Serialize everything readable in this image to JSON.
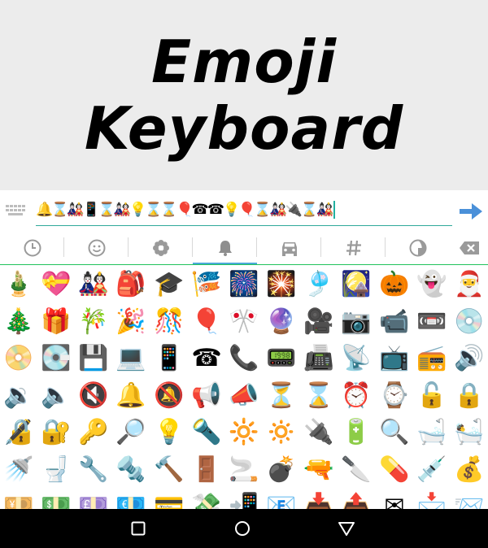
{
  "banner": {
    "line1": "Emoji",
    "line2": "Keyboard"
  },
  "input": {
    "text": "🔔⌛🎎📱⌛🎎💡⌛⌛🎈☎☎💡🎈⌛🎎🔌⌛🎎"
  },
  "tabs": [
    {
      "name": "recent",
      "icon": "clock-icon"
    },
    {
      "name": "smileys",
      "icon": "smiley-icon"
    },
    {
      "name": "flowers",
      "icon": "flower-icon"
    },
    {
      "name": "bell",
      "icon": "bell-icon",
      "active": true
    },
    {
      "name": "car",
      "icon": "car-icon"
    },
    {
      "name": "symbols",
      "icon": "hash-icon"
    },
    {
      "name": "themes",
      "icon": "moon-icon"
    }
  ],
  "emoji_rows": [
    [
      "🎍",
      "💝",
      "🎎",
      "🎒",
      "🎓",
      "🎏",
      "🎆",
      "🎇",
      "🎐",
      "🎑",
      "🎃",
      "👻",
      "🎅"
    ],
    [
      "🎄",
      "🎁",
      "🎋",
      "🎉",
      "🎊",
      "🎈",
      "🎌",
      "🔮",
      "🎥",
      "📷",
      "📹",
      "📼",
      "💿"
    ],
    [
      "📀",
      "💽",
      "💾",
      "💻",
      "📱",
      "☎",
      "📞",
      "📟",
      "📠",
      "📡",
      "📺",
      "📻",
      "🔊"
    ],
    [
      "🔉",
      "🔈",
      "🔇",
      "🔔",
      "🔕",
      "📢",
      "📣",
      "⏳",
      "⌛",
      "⏰",
      "⌚",
      "🔓",
      "🔒"
    ],
    [
      "🔏",
      "🔐",
      "🔑",
      "🔎",
      "💡",
      "🔦",
      "🔆",
      "🔅",
      "🔌",
      "🔋",
      "🔍",
      "🛁",
      "🛀"
    ],
    [
      "🚿",
      "🚽",
      "🔧",
      "🔩",
      "🔨",
      "🚪",
      "🚬",
      "💣",
      "🔫",
      "🔪",
      "💊",
      "💉",
      "💰"
    ],
    [
      "💴",
      "💵",
      "💷",
      "💶",
      "💳",
      "💸",
      "📲",
      "📧",
      "📥",
      "📤",
      "✉",
      "📩",
      "📨"
    ]
  ],
  "colors": {
    "banner_bg": "#ececec",
    "accent_line": "#2fa99a",
    "send_arrow": "#4a90d9",
    "active_tab": "#4aa9d8",
    "tab_divider": "#21c25b",
    "navbar": "#000000"
  }
}
